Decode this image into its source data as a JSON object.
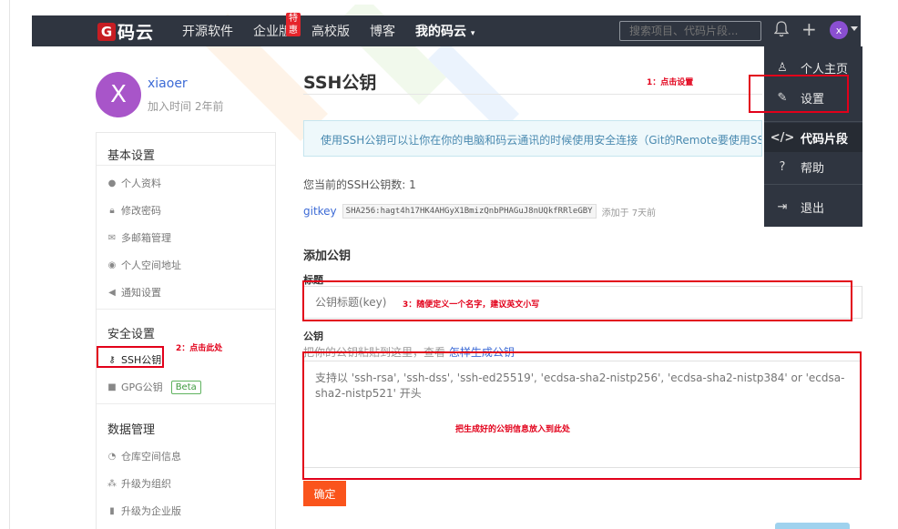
{
  "nav": {
    "logo_letter": "G",
    "logo_text": "码云",
    "items": [
      "开源软件",
      "企业版",
      "高校版",
      "博客",
      "我的码云"
    ],
    "hot_badge": "特惠",
    "search_placeholder": "搜索项目、代码片段...",
    "avatar_letter": "x"
  },
  "dropdown": {
    "items": [
      "个人主页",
      "设置",
      "代码片段",
      "帮助",
      "退出"
    ]
  },
  "profile": {
    "avatar_letter": "X",
    "name": "xiaoer",
    "joined": "加入时间 2年前"
  },
  "sidebar": {
    "basic_head": "基本设置",
    "basic_items": [
      "个人资料",
      "修改密码",
      "多邮箱管理",
      "个人空间地址",
      "通知设置"
    ],
    "security_head": "安全设置",
    "security_items": [
      "SSH公钥",
      "GPG公钥"
    ],
    "beta": "Beta",
    "data_head": "数据管理",
    "data_items": [
      "仓库空间信息",
      "升级为组织",
      "升级为企业版"
    ]
  },
  "main": {
    "title": "SSH公钥",
    "info": "使用SSH公钥可以让你在你的电脑和码云通讯的时候使用安全连接（Git的Remote要使用SSH地址）",
    "count_text": "您当前的SSH公钥数: 1",
    "key_name": "gitkey",
    "key_fingerprint": "SHA256:hagt4h17HK4AHGyX1BmizQnbPHAGuJ8nUQkfRRleGBY",
    "key_added": "添加于 7天前",
    "add_head": "添加公钥",
    "title_label": "标题",
    "title_placeholder": "公钥标题(key)",
    "key_label": "公钥",
    "hint_text": "把你的公钥粘贴到这里，查看",
    "hint_link": "怎样生成公钥",
    "key_placeholder": "支持以 'ssh-rsa', 'ssh-dss', 'ssh-ed25519', 'ecdsa-sha2-nistp256', 'ecdsa-sha2-nistp384' or 'ecdsa-sha2-nistp521' 开头",
    "confirm": "确定"
  },
  "annotations": {
    "a1": "1：点击设置",
    "a2": "2：点击此处",
    "a3": "3：随便定义一个名字，建议英文小写",
    "a4": "把生成好的公钥信息放入到此处"
  },
  "colors": {
    "nav_bg": "#2f3540",
    "accent_orange": "#fa541c",
    "annotation_red": "#e2001a",
    "link_blue": "#3d6bd6"
  }
}
